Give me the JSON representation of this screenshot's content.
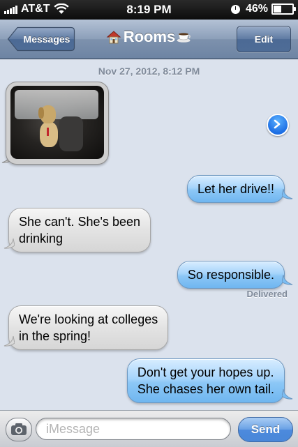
{
  "status_bar": {
    "carrier": "AT&T",
    "time": "8:19 PM",
    "battery_percent": "46%",
    "battery_level": 0.46,
    "signal_bars": 5,
    "icons": [
      "signal-bars-icon",
      "wifi-icon",
      "clock-icon",
      "battery-icon"
    ]
  },
  "nav": {
    "back_label": "Messages",
    "title": "Rooms",
    "title_icons": [
      "house-icon",
      "coffee-icon"
    ],
    "edit_label": "Edit"
  },
  "conversation": {
    "timestamp": "Nov 27, 2012, 8:12 PM",
    "photo_message": {
      "sender": "them",
      "content": "photo of a dog sitting in a car seat"
    },
    "messages": [
      {
        "sender": "me",
        "text": "Let her drive!!"
      },
      {
        "sender": "them",
        "lines": [
          "She can't. She's been",
          "drinking"
        ]
      },
      {
        "sender": "me",
        "text": "So responsible."
      },
      {
        "sender": "them",
        "lines": [
          "We're looking at colleges",
          "in the spring!"
        ]
      },
      {
        "sender": "me",
        "lines": [
          "Don't get your hopes up.",
          "She chases her own tail."
        ]
      }
    ],
    "delivered_label": "Delivered"
  },
  "input_bar": {
    "placeholder": "iMessage",
    "value": "",
    "send_label": "Send"
  },
  "colors": {
    "sent_bubble": "#8cc7f6",
    "received_bubble": "#e3e3e3",
    "nav_bar": "#7d91ad",
    "send_button": "#3d82dd",
    "background": "#dbe2ed"
  }
}
